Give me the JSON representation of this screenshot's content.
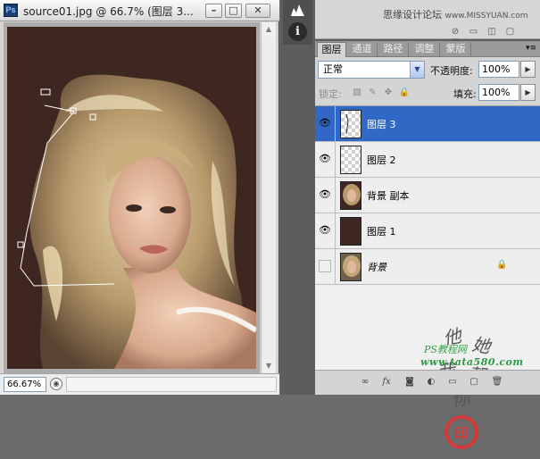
{
  "document": {
    "title": "source01.jpg @ 66.7% (图层 3...",
    "app_logo": "Ps",
    "window_buttons": {
      "minimize": "–",
      "maximize": "□",
      "close": "✕"
    },
    "zoom": "66.67%"
  },
  "top_panel": {
    "credit": "思缘设计论坛",
    "credit_url": "www.MISSYUAN.com"
  },
  "dock": {
    "info_icon": "i"
  },
  "layers_panel": {
    "tabs": [
      {
        "label": "图层",
        "active": true
      },
      {
        "label": "通道",
        "active": false
      },
      {
        "label": "路径",
        "active": false
      },
      {
        "label": "调整",
        "active": false
      },
      {
        "label": "蒙版",
        "active": false
      }
    ],
    "blend_mode": "正常",
    "opacity_label": "不透明度:",
    "opacity_value": "100%",
    "lock_label": "锁定:",
    "fill_label": "填充:",
    "fill_value": "100%",
    "layers": [
      {
        "name": "图层 3",
        "visible": true,
        "selected": true,
        "thumb": "checker-path"
      },
      {
        "name": "图层 2",
        "visible": true,
        "selected": false,
        "thumb": "checker"
      },
      {
        "name": "背景 副本",
        "visible": true,
        "selected": false,
        "thumb": "photo"
      },
      {
        "name": "图层 1",
        "visible": true,
        "selected": false,
        "thumb": "dark"
      },
      {
        "name": "背景",
        "visible": false,
        "selected": false,
        "thumb": "photo",
        "locked": true
      }
    ]
  },
  "watermark": {
    "signature_chars": [
      "他",
      "她",
      "我",
      "帮",
      "你"
    ],
    "seal_text": "印",
    "footer": "PS教程网",
    "url": "www.tata580.com"
  },
  "colors": {
    "selected_layer": "#3168c6",
    "canvas_bg": "#3d2720",
    "panel_bg": "#d4d4d4"
  }
}
